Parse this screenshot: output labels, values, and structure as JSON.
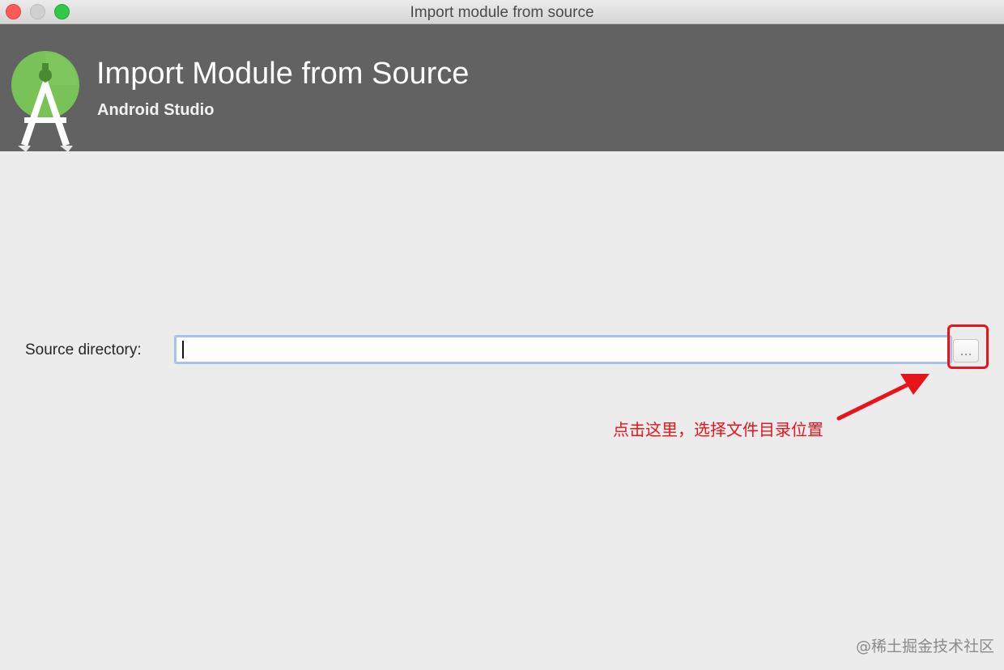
{
  "window": {
    "title": "Import module from source"
  },
  "header": {
    "title": "Import Module from Source",
    "subtitle": "Android Studio",
    "logo_icon": "android-studio-logo"
  },
  "form": {
    "source_label": "Source directory:",
    "source_value": "",
    "browse_label": "..."
  },
  "annotation": {
    "text": "点击这里，选择文件目录位置",
    "color": "#e8141a"
  },
  "watermark": {
    "text": "@稀土掘金技术社区"
  },
  "colors": {
    "header_bg": "#626262",
    "body_bg": "#ececec",
    "logo_green": "#78c257",
    "accent_red": "#e8141a"
  }
}
